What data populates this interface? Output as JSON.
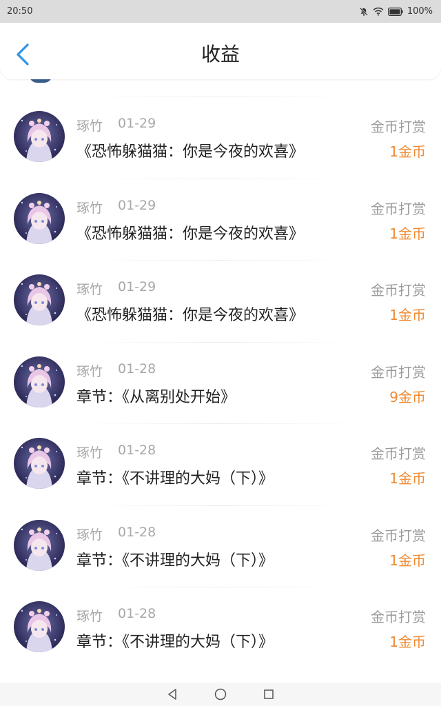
{
  "status_bar": {
    "time": "20:50",
    "battery": "100%"
  },
  "header": {
    "title": "收益",
    "back_icon": "chevron-left-icon"
  },
  "colors": {
    "accent": "#2f95e8",
    "amount": "#f08a32",
    "muted": "#a8a8a8"
  },
  "records": [
    {
      "user": "琢竹",
      "date": "01-29",
      "work": "《恐怖躲猫猫：你是今夜的欢喜》",
      "type": "金币打赏",
      "amount": "1金币"
    },
    {
      "user": "琢竹",
      "date": "01-29",
      "work": "《恐怖躲猫猫：你是今夜的欢喜》",
      "type": "金币打赏",
      "amount": "1金币"
    },
    {
      "user": "琢竹",
      "date": "01-29",
      "work": "《恐怖躲猫猫：你是今夜的欢喜》",
      "type": "金币打赏",
      "amount": "1金币"
    },
    {
      "user": "琢竹",
      "date": "01-28",
      "work": "章节：《从离别处开始》",
      "type": "金币打赏",
      "amount": "9金币"
    },
    {
      "user": "琢竹",
      "date": "01-28",
      "work": "章节：《不讲理的大妈（下）》",
      "type": "金币打赏",
      "amount": "1金币"
    },
    {
      "user": "琢竹",
      "date": "01-28",
      "work": "章节：《不讲理的大妈（下）》",
      "type": "金币打赏",
      "amount": "1金币"
    },
    {
      "user": "琢竹",
      "date": "01-28",
      "work": "章节：《不讲理的大妈（下）》",
      "type": "金币打赏",
      "amount": "1金币"
    }
  ],
  "nav": {
    "back": "back-triangle-icon",
    "home": "home-circle-icon",
    "recent": "recent-square-icon"
  }
}
